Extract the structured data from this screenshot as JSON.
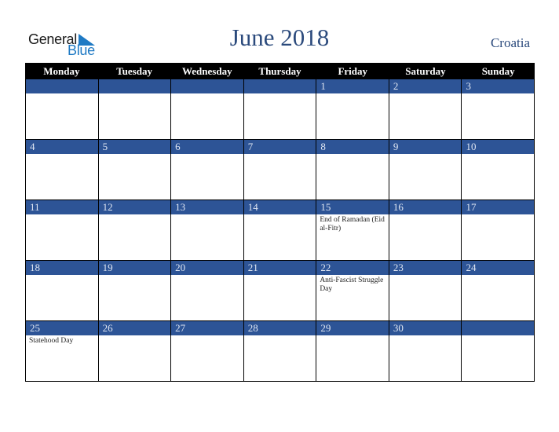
{
  "logo": {
    "word1": "General",
    "word2": "Blue"
  },
  "header": {
    "title": "June 2018",
    "country": "Croatia"
  },
  "colors": {
    "band": "#2d5496",
    "header_bg": "#000000",
    "title": "#2b4a7c",
    "logo_blue": "#1f7ac4"
  },
  "days": [
    "Monday",
    "Tuesday",
    "Wednesday",
    "Thursday",
    "Friday",
    "Saturday",
    "Sunday"
  ],
  "weeks": [
    [
      {
        "d": "",
        "e": ""
      },
      {
        "d": "",
        "e": ""
      },
      {
        "d": "",
        "e": ""
      },
      {
        "d": "",
        "e": ""
      },
      {
        "d": "1",
        "e": ""
      },
      {
        "d": "2",
        "e": ""
      },
      {
        "d": "3",
        "e": ""
      }
    ],
    [
      {
        "d": "4",
        "e": ""
      },
      {
        "d": "5",
        "e": ""
      },
      {
        "d": "6",
        "e": ""
      },
      {
        "d": "7",
        "e": ""
      },
      {
        "d": "8",
        "e": ""
      },
      {
        "d": "9",
        "e": ""
      },
      {
        "d": "10",
        "e": ""
      }
    ],
    [
      {
        "d": "11",
        "e": ""
      },
      {
        "d": "12",
        "e": ""
      },
      {
        "d": "13",
        "e": ""
      },
      {
        "d": "14",
        "e": ""
      },
      {
        "d": "15",
        "e": "End of Ramadan (Eid al-Fitr)"
      },
      {
        "d": "16",
        "e": ""
      },
      {
        "d": "17",
        "e": ""
      }
    ],
    [
      {
        "d": "18",
        "e": ""
      },
      {
        "d": "19",
        "e": ""
      },
      {
        "d": "20",
        "e": ""
      },
      {
        "d": "21",
        "e": ""
      },
      {
        "d": "22",
        "e": "Anti-Fascist Struggle Day"
      },
      {
        "d": "23",
        "e": ""
      },
      {
        "d": "24",
        "e": ""
      }
    ],
    [
      {
        "d": "25",
        "e": "Statehood Day"
      },
      {
        "d": "26",
        "e": ""
      },
      {
        "d": "27",
        "e": ""
      },
      {
        "d": "28",
        "e": ""
      },
      {
        "d": "29",
        "e": ""
      },
      {
        "d": "30",
        "e": ""
      },
      {
        "d": "",
        "e": ""
      }
    ]
  ]
}
